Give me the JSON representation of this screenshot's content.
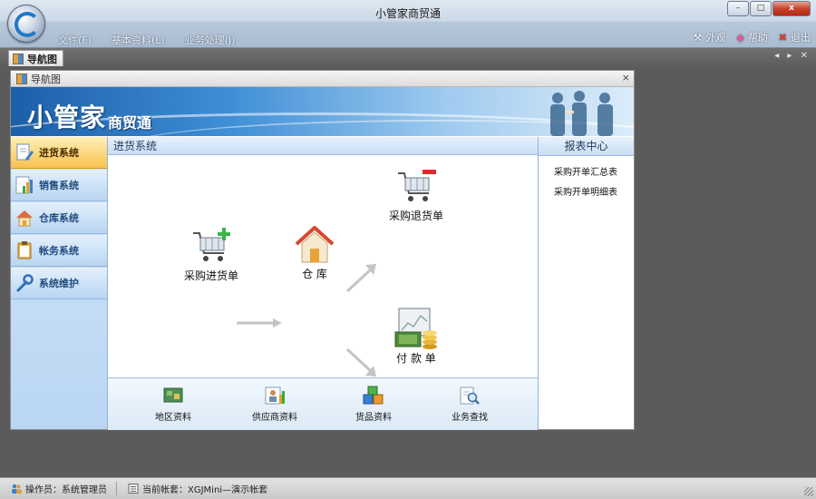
{
  "window": {
    "title": "小管家商贸通",
    "controls": {
      "minimize": "–",
      "maximize": "□",
      "close": "x"
    }
  },
  "menu": [
    "文件(F)",
    "基本资料(L)",
    "业务处理(J)"
  ],
  "toolbar": {
    "appearance": "外观",
    "help": "帮助",
    "exit": "退出"
  },
  "tabs": {
    "active": "导航图",
    "tools": "◂ ▸ ✕"
  },
  "panel": {
    "title": "导航图",
    "close": "×",
    "brand_main": "小管家",
    "brand_sub": "商贸通"
  },
  "sidebar": {
    "items": [
      {
        "label": "进货系统",
        "icon": "document-edit-icon",
        "active": true
      },
      {
        "label": "销售系统",
        "icon": "bar-chart-icon",
        "active": false
      },
      {
        "label": "仓库系统",
        "icon": "home-icon",
        "active": false
      },
      {
        "label": "帐务系统",
        "icon": "clipboard-icon",
        "active": false
      },
      {
        "label": "系统维护",
        "icon": "wrench-icon",
        "active": false
      }
    ]
  },
  "section": {
    "title": "进货系统"
  },
  "flow": {
    "purchase_in": "采购进货单",
    "warehouse": "仓 库",
    "purchase_return": "采购退货单",
    "payment": "付 款 单"
  },
  "quick": [
    {
      "label": "地区资料",
      "icon": "map-icon"
    },
    {
      "label": "供应商资料",
      "icon": "supplier-icon"
    },
    {
      "label": "货品资料",
      "icon": "boxes-icon"
    },
    {
      "label": "业务查找",
      "icon": "search-document-icon"
    }
  ],
  "reports": {
    "title": "报表中心",
    "links": [
      "采购开单汇总表",
      "采购开单明细表"
    ]
  },
  "status": {
    "operator": "操作员：系统管理员",
    "account": "当前帐套：XGJMini—演示帐套"
  },
  "colors": {
    "active_side": "#f7c24e",
    "side_bg": "#bad6f3",
    "banner": "#3f8ed6"
  }
}
